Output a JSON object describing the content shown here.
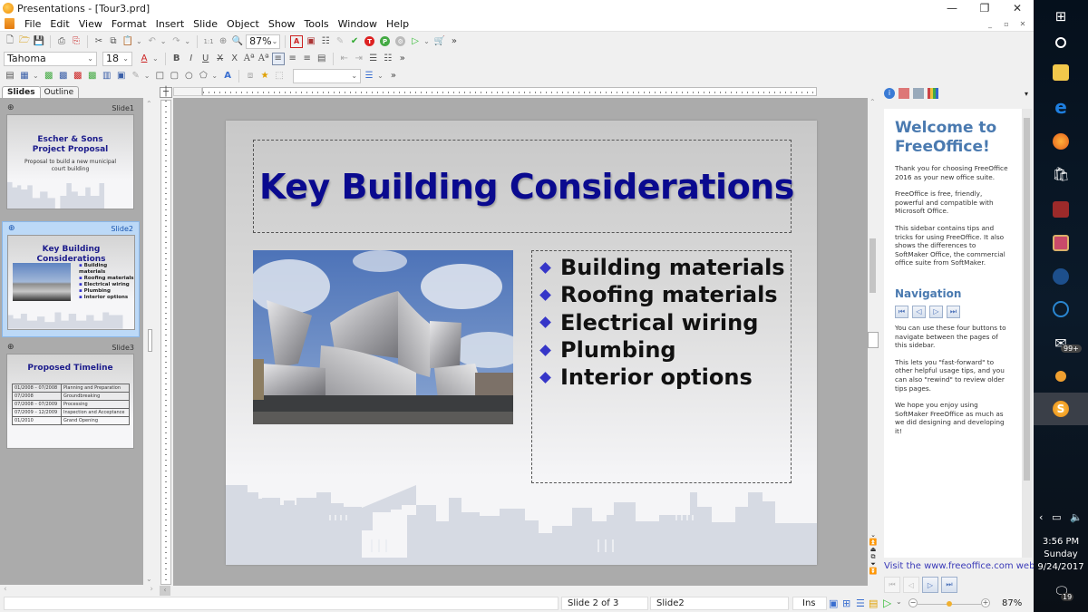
{
  "window": {
    "title": "Presentations - [Tour3.prd]",
    "controls": [
      "minimize",
      "restore",
      "close"
    ]
  },
  "menu": [
    "File",
    "Edit",
    "View",
    "Format",
    "Insert",
    "Slide",
    "Object",
    "Show",
    "Tools",
    "Window",
    "Help"
  ],
  "toolbar": {
    "zoom_value": "87%",
    "font_name": "Tahoma",
    "font_size": "18",
    "style_combo_value": "",
    "more": "»"
  },
  "panel_tabs": {
    "slides": "Slides",
    "outline": "Outline"
  },
  "thumbnails": [
    {
      "label": "Slide1",
      "title_line1": "Escher & Sons",
      "title_line2": "Project Proposal",
      "subtitle_line1": "Proposal to build a new municipal",
      "subtitle_line2": "court building"
    },
    {
      "label": "Slide2",
      "title": "Key Building Considerations",
      "bullets": [
        "Building materials",
        "Roofing materials",
        "Electrical wiring",
        "Plumbing",
        "Interior options"
      ]
    },
    {
      "label": "Slide3",
      "title": "Proposed Timeline",
      "table": [
        [
          "01/2008 – 07/2008",
          "Planning and Preparation"
        ],
        [
          "07/2008",
          "Groundbreaking"
        ],
        [
          "07/2008 – 07/2009",
          "Processing"
        ],
        [
          "07/2009 – 12/2009",
          "Inspection and Acceptance"
        ],
        [
          "01/2010",
          "Grand Opening"
        ]
      ]
    }
  ],
  "slide": {
    "title": "Key Building Considerations",
    "bullets": [
      "Building materials",
      "Roofing materials",
      "Electrical wiring",
      "Plumbing",
      "Interior options"
    ],
    "bullet_color": "#3636c8",
    "title_color": "#0a0a8f",
    "image_alt": "building-photo"
  },
  "sidebar": {
    "heading": "Welcome to FreeOffice!",
    "para1": "Thank you for choosing FreeOffice 2016 as your new office suite.",
    "para2": "FreeOffice is free, friendly, powerful and compatible with Microsoft Office.",
    "para3": "This sidebar contains tips and tricks for using FreeOffice. It also shows the differences to SoftMaker Office, the commercial office suite from SoftMaker.",
    "nav_heading": "Navigation",
    "para4": "You can use these four buttons to navigate between the pages of this sidebar.",
    "para5": "This lets you \"fast-forward\" to other helpful usage tips, and you can also \"rewind\" to review older tips pages.",
    "para6": "We hope you enjoy using SoftMaker FreeOffice as much as we did designing and developing it!",
    "link": "Visit the www.freeoffice.com web site",
    "heading_color": "#4a7ab0"
  },
  "status": {
    "slide_pos": "Slide 2 of 3",
    "slide_name": "Slide2",
    "mode": "Ins",
    "zoom": "87%",
    "zoom_fraction": 0.5
  },
  "taskbar": {
    "time": "3:56 PM",
    "day": "Sunday",
    "date": "9/24/2017",
    "mail_badge": "99+",
    "notification_count": "19"
  }
}
